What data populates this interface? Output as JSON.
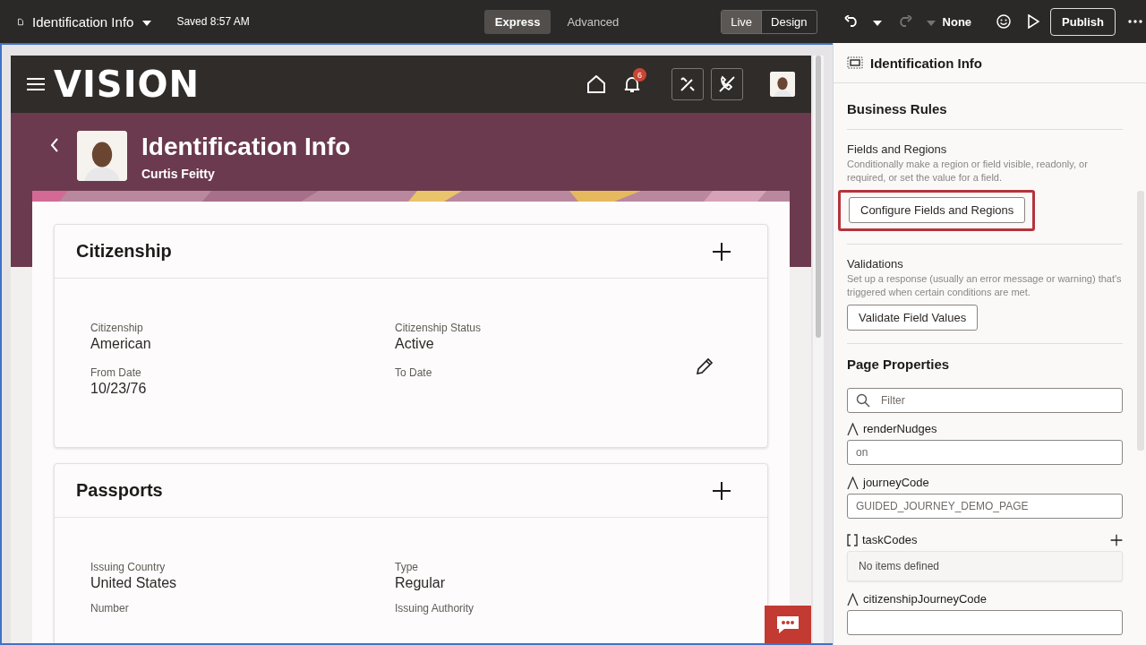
{
  "topbar": {
    "title": "Identification Info",
    "saved": "Saved 8:57 AM",
    "modes": [
      {
        "label": "Express",
        "selected": true
      },
      {
        "label": "Advanced",
        "selected": false
      }
    ],
    "views": [
      {
        "label": "Live",
        "selected": true
      },
      {
        "label": "Design",
        "selected": false
      }
    ],
    "redo_disabled": true,
    "context": "None",
    "publish": "Publish"
  },
  "app": {
    "brand": "VISION",
    "notification_count": "6",
    "title": "Identification Info",
    "subtitle": "Curtis Feitty",
    "sections": [
      {
        "title": "Citizenship",
        "editable": true,
        "fields": [
          {
            "label": "Citizenship",
            "value": "American"
          },
          {
            "label": "Citizenship Status",
            "value": "Active"
          },
          {
            "label": "From Date",
            "value": "10/23/76"
          },
          {
            "label": "To Date"
          }
        ]
      },
      {
        "title": "Passports",
        "editable": false,
        "fields": [
          {
            "label": "Issuing Country",
            "value": "United States"
          },
          {
            "label": "Type",
            "value": "Regular"
          },
          {
            "label": "Number"
          },
          {
            "label": "Issuing Authority"
          }
        ]
      }
    ]
  },
  "panel": {
    "title": "Identification Info",
    "business_rules": {
      "title": "Business Rules",
      "rules": [
        {
          "title": "Fields and Regions",
          "description": "Conditionally make a region or field visible, readonly, or required, or set the value for a field.",
          "button": "Configure Fields and Regions",
          "highlighted": true
        },
        {
          "title": "Validations",
          "description": "Set up a response (usually an error message or warning) that's triggered when certain conditions are met.",
          "button": "Validate Field Values",
          "highlighted": false
        }
      ]
    },
    "page_properties": {
      "title": "Page Properties",
      "filter_placeholder": "Filter",
      "properties": [
        {
          "kind": "string",
          "name": "renderNudges",
          "value": "on"
        },
        {
          "kind": "string",
          "name": "journeyCode",
          "value": "GUIDED_JOURNEY_DEMO_PAGE"
        },
        {
          "kind": "array",
          "name": "taskCodes",
          "empty_text": "No items defined"
        },
        {
          "kind": "string",
          "name": "citizenshipJourneyCode"
        }
      ]
    }
  }
}
